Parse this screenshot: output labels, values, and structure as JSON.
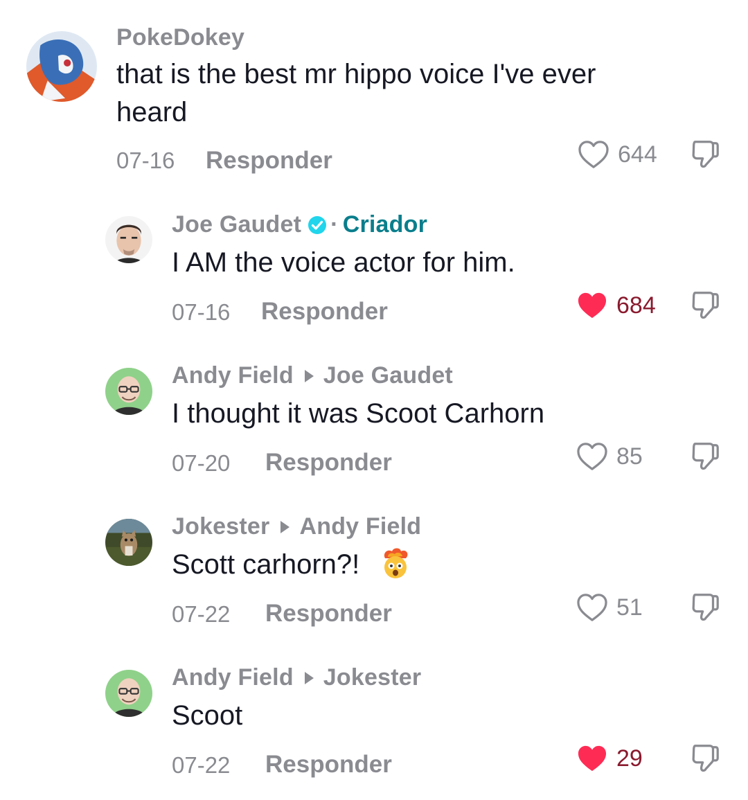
{
  "comments": [
    {
      "author": "PokeDokey",
      "avatar_icon": "pokemon-avatar",
      "text_line1": "that is the best mr hippo voice I've ever",
      "text_line2": "heard",
      "date": "07-16",
      "reply_label": "Responder",
      "likes": "644",
      "liked": false
    },
    {
      "author": "Joe Gaudet",
      "verified_icon": "verified-badge-icon",
      "separator": "·",
      "creator_label": "Criador",
      "avatar_icon": "man-portrait-avatar",
      "text": "I AM the voice actor for him.",
      "date": "07-16",
      "reply_label": "Responder",
      "likes": "684",
      "liked": true
    },
    {
      "author": "Andy Field",
      "reply_to": "Joe Gaudet",
      "avatar_icon": "bald-man-glasses-avatar",
      "text": "I thought it was Scoot Carhorn",
      "date": "07-20",
      "reply_label": "Responder",
      "likes": "85",
      "liked": false
    },
    {
      "author": "Jokester",
      "reply_to": "Andy Field",
      "avatar_icon": "cat-avatar",
      "text": "Scott carhorn?!",
      "emoji": "exploding-head-emoji",
      "date": "07-22",
      "reply_label": "Responder",
      "likes": "51",
      "liked": false
    },
    {
      "author": "Andy Field",
      "reply_to": "Jokester",
      "avatar_icon": "bald-man-glasses-avatar",
      "text": "Scoot",
      "date": "07-22",
      "reply_label": "Responder",
      "likes": "29",
      "liked": true
    }
  ],
  "colors": {
    "muted": "#8a8b91",
    "text": "#161823",
    "creator": "#0a7e8c",
    "like_active": "#fe2c55",
    "like_count_active": "#8a1a2e",
    "verified": "#20d5ec"
  }
}
